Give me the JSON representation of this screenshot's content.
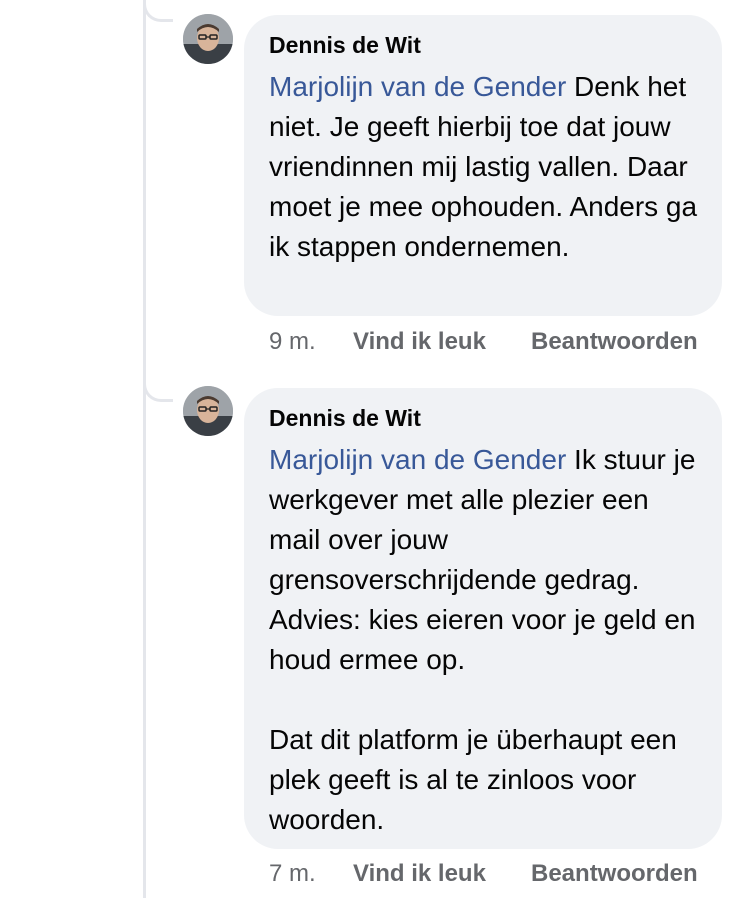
{
  "comments": [
    {
      "author": "Dennis de Wit",
      "mention": "Marjolijn van de Gender",
      "text": " Denk het niet. Je geeft hierbij toe dat jouw vriendinnen mij lastig vallen. Daar moet je mee ophouden. Anders ga ik stappen ondernemen.",
      "time": "9 m.",
      "like_label": "Vind ik leuk",
      "reply_label": "Beantwoorden"
    },
    {
      "author": "Dennis de Wit",
      "mention": "Marjolijn van de Gender",
      "text": " Ik stuur je werkgever met alle plezier een mail over jouw grensoverschrijdende gedrag. Advies: kies eieren voor je geld en houd ermee op.\n\nDat dit platform je überhaupt een plek geeft is al te zinloos voor woorden.",
      "time": "7 m.",
      "like_label": "Vind ik leuk",
      "reply_label": "Beantwoorden"
    }
  ]
}
